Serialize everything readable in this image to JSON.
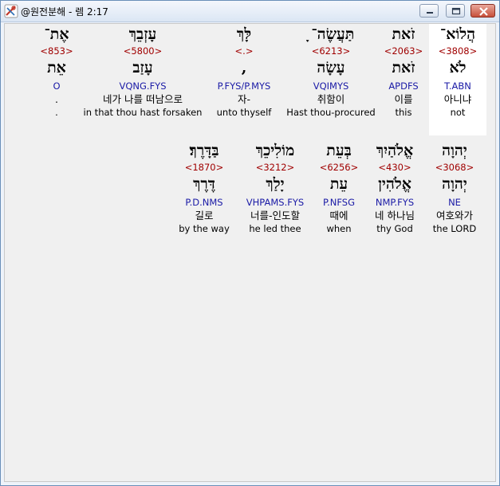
{
  "window": {
    "title": "@원전분해 - 렘 2:17",
    "buttons": {
      "minimize": "minimize-icon",
      "maximize": "maximize-icon",
      "close": "close-icon"
    }
  },
  "colors": {
    "strong": "#a00000",
    "morph": "#1a1aa6",
    "highlight": "#ffffff"
  },
  "rows": [
    {
      "words": [
        {
          "hebrew": "הֲלוֹא־",
          "strong": "<3808>",
          "lexeme": "לֹא",
          "morph": "T.ABN",
          "korean": "아니냐",
          "english": "not",
          "highlight": true
        },
        {
          "hebrew": "זֹאת",
          "strong": "<2063>",
          "lexeme": "זֹאת",
          "morph": "APDFS",
          "korean": "이를",
          "english": "this",
          "highlight": false
        },
        {
          "hebrew": "תַּעֲשֶׂה־ ָ",
          "strong": "<6213>",
          "lexeme": "עָשָׂה",
          "morph": "VQIMYS",
          "korean": "취함이",
          "english": "Hast thou-procured",
          "highlight": false
        },
        {
          "hebrew": "לָּךְ",
          "strong": "<.>",
          "lexeme": ",",
          "morph": "P.FYS/P.MYS",
          "korean": "자-",
          "english": "unto thyself",
          "highlight": false
        },
        {
          "hebrew": "עָזְבֵךְ",
          "strong": "<5800>",
          "lexeme": "עָזַב",
          "morph": "VQNG.FYS",
          "korean": "네가 나를 떠남으로",
          "english": "in that thou hast forsaken",
          "highlight": false
        },
        {
          "hebrew": "אֶת־",
          "strong": "<853>",
          "lexeme": "אֵת",
          "morph": "O",
          "korean": ".",
          "english": ".",
          "highlight": false
        }
      ]
    },
    {
      "words": [
        {
          "hebrew": "יְהוָה",
          "strong": "<3068>",
          "lexeme": "יְהוָה",
          "morph": "NE",
          "korean": "여호와가",
          "english": "the LORD",
          "highlight": false
        },
        {
          "hebrew": "אֱלֹהַיִךְ",
          "strong": "<430>",
          "lexeme": "אֱלֹהִין",
          "morph": "NMP.FYS",
          "korean": "네 하나님",
          "english": "thy God",
          "highlight": false
        },
        {
          "hebrew": "בְּעֵת",
          "strong": "<6256>",
          "lexeme": "עֵת",
          "morph": "P.NFSG",
          "korean": "때에",
          "english": "when",
          "highlight": false
        },
        {
          "hebrew": "מוֹלִיכֵךְ",
          "strong": "<3212>",
          "lexeme": "יָלַךְ",
          "morph": "VHPAMS.FYS",
          "korean": "너를-인도할",
          "english": "he led thee",
          "highlight": false
        },
        {
          "hebrew": "בַּדָּרֶךְ׃",
          "strong": "<1870>",
          "lexeme": "דֶּרֶךְ",
          "morph": "P.D.NMS",
          "korean": "길로",
          "english": "by the way",
          "highlight": false
        }
      ]
    }
  ]
}
